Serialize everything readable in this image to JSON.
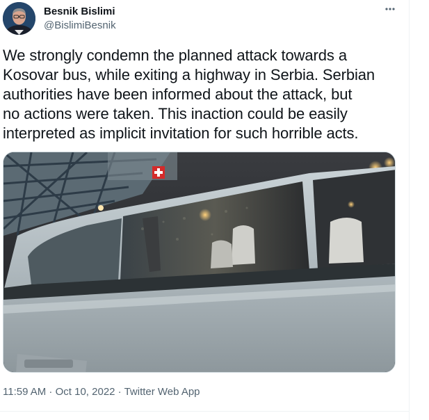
{
  "author": {
    "name": "Besnik Bislimi",
    "handle": "@BislimiBesnik"
  },
  "tweet": {
    "lines": [
      "We strongly condemn the planned attack towards a",
      "Kosovar bus, while exiting a highway in Serbia. Serbian",
      "authorities have been informed about the attack, but",
      "no actions were taken. This inaction could be easily",
      "interpreted as implicit invitation for such horrible acts."
    ]
  },
  "meta": {
    "time": "11:59 AM",
    "separator1": " · ",
    "date": "Oct 10, 2022",
    "separator2": " · ",
    "source": "Twitter Web App"
  },
  "icons": {
    "more": "more-horizontal-icon"
  },
  "colors": {
    "text": "#0f1419",
    "secondary": "#536471",
    "divider": "#eff3f4"
  }
}
